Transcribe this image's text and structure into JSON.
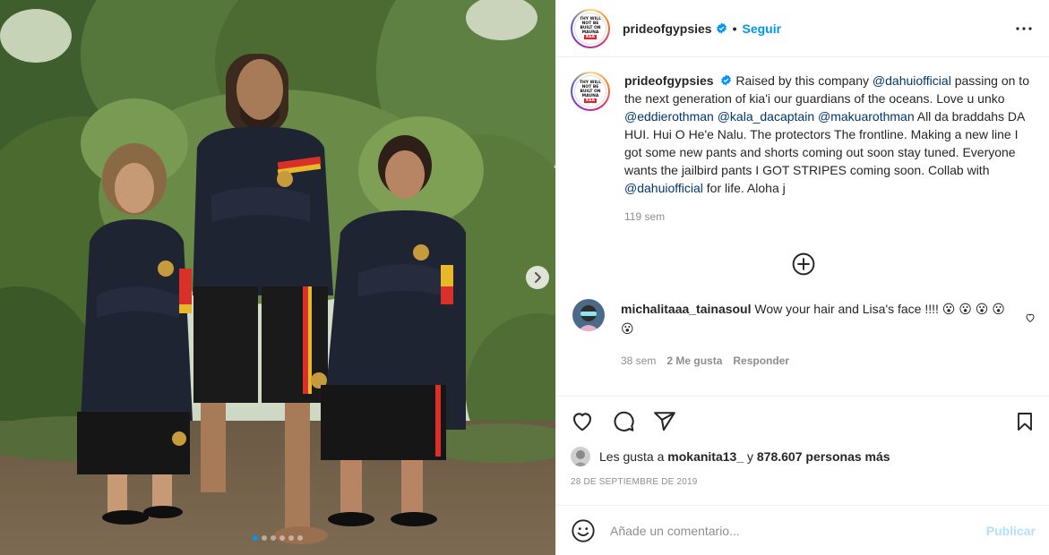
{
  "post": {
    "username": "prideofgypsies",
    "follow_label": "Seguir",
    "separator": "•",
    "avatar_badge_lines": [
      "THY WILL",
      "NOT BE",
      "BUILT ON",
      "MAUNA",
      "KEA"
    ],
    "caption": {
      "segments": [
        {
          "t": "Raised by this company ",
          "m": false
        },
        {
          "t": "@dahuiofficial",
          "m": true
        },
        {
          "t": " passing on to the next generation of kia'i our guardians of the oceans. Love u unko ",
          "m": false
        },
        {
          "t": "@eddierothman",
          "m": true
        },
        {
          "t": " ",
          "m": false
        },
        {
          "t": "@kala_dacaptain",
          "m": true
        },
        {
          "t": " ",
          "m": false
        },
        {
          "t": "@makuarothman",
          "m": true
        },
        {
          "t": " All da braddahs DA HUI. Hui O He'e Nalu. The protectors The frontline. Making a new line I got some new pants and shorts coming out soon stay tuned. Everyone wants the jailbird pants I GOT STRIPES coming soon. Collab with ",
          "m": false
        },
        {
          "t": "@dahuiofficial",
          "m": true
        },
        {
          "t": " for life. Aloha j",
          "m": false
        }
      ],
      "time": "119 sem"
    },
    "comments": [
      {
        "username": "michalitaaa_tainasoul",
        "text": "Wow your hair and Lisa's face !!!! 😮 😮 😮 😮 😮",
        "time": "38 sem",
        "likes": "2 Me gusta",
        "reply": "Responder"
      }
    ],
    "likes": {
      "prefix": "Les gusta a",
      "user": "mokanita13_",
      "middle": "y",
      "count": "878.607 personas más"
    },
    "date": "28 DE SEPTIEMBRE DE 2019",
    "add_comment": {
      "placeholder": "Añade un comentario...",
      "publish": "Publicar"
    },
    "carousel": {
      "total": 6,
      "active": 1
    }
  },
  "colors": {
    "accent": "#0095f6",
    "mention": "#00376b",
    "muted": "#8e8e8e",
    "publish_disabled": "#b2dffc"
  },
  "icons": [
    "more-options-icon",
    "verified-icon",
    "load-more-icon",
    "heart-icon",
    "comment-icon",
    "share-icon",
    "save-icon",
    "emoji-icon",
    "next-arrow-icon"
  ]
}
